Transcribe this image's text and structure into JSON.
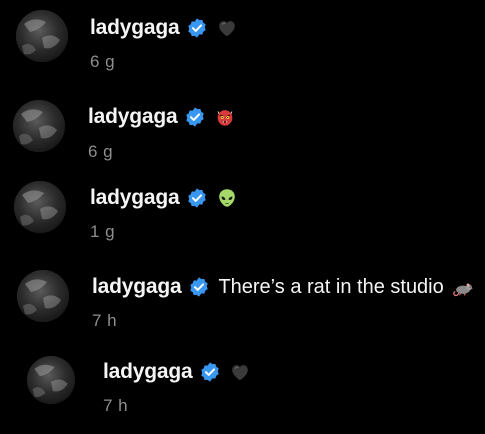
{
  "comments": [
    {
      "username": "ladygaga",
      "emoji": "black-heart-icon",
      "text": "",
      "time": "6 g"
    },
    {
      "username": "ladygaga",
      "emoji": "ogre-mask-icon",
      "text": "",
      "time": "6 g"
    },
    {
      "username": "ladygaga",
      "emoji": "alien-icon",
      "text": "",
      "time": "1 g"
    },
    {
      "username": "ladygaga",
      "emoji": "rat-icon",
      "text": "There’s a rat in the studio",
      "time": "7 h"
    },
    {
      "username": "ladygaga",
      "emoji": "black-heart-icon",
      "text": "",
      "time": "7 h"
    }
  ],
  "colors": {
    "background": "#000000",
    "username": "#f5f5f5",
    "timestamp": "#8e8e8e",
    "verified": "#3897f0"
  }
}
